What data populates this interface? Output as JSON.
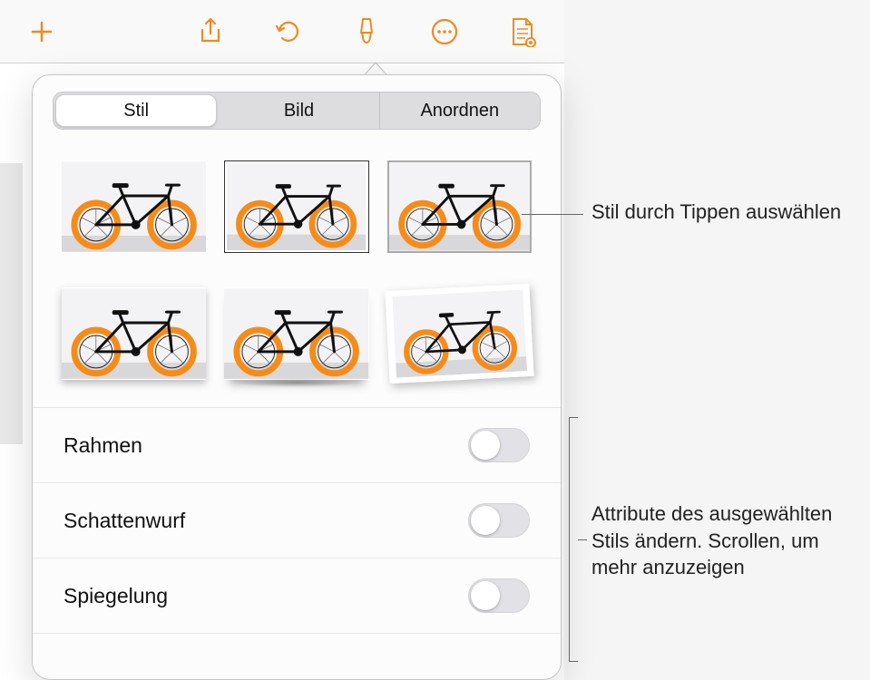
{
  "toolbar": {
    "icons": [
      "add",
      "share",
      "undo",
      "brush",
      "more",
      "document"
    ]
  },
  "popover": {
    "tabs": {
      "style": "Stil",
      "image": "Bild",
      "arrange": "Anordnen"
    },
    "active_tab": "style",
    "style_thumb_count": 6,
    "options": {
      "frame": "Rahmen",
      "shadow": "Schattenwurf",
      "reflection": "Spiegelung"
    },
    "toggles": {
      "frame": false,
      "shadow": false,
      "reflection": false
    }
  },
  "callouts": {
    "style_select": "Stil durch Tippen auswählen",
    "attributes": "Attribute des ausgewählten Stils ändern. Scrollen, um mehr anzuzeigen"
  },
  "colors": {
    "accent": "#f08a1f",
    "tire": "#f58c1a"
  }
}
